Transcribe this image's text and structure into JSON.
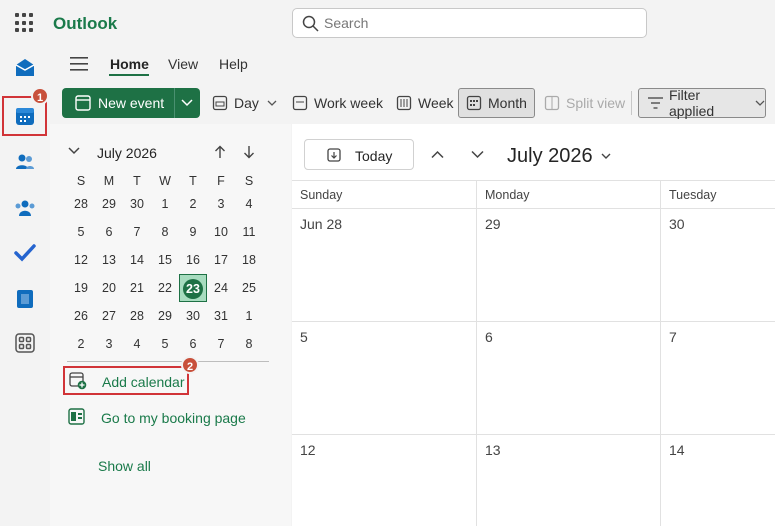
{
  "app": {
    "name": "Outlook"
  },
  "search": {
    "placeholder": "Search"
  },
  "tabs": [
    {
      "label": "Home"
    },
    {
      "label": "View"
    },
    {
      "label": "Help"
    }
  ],
  "ribbon": {
    "new_event": "New event",
    "day": "Day",
    "work_week": "Work week",
    "week": "Week",
    "month": "Month",
    "split_view": "Split view",
    "filter": "Filter applied"
  },
  "mini_calendar": {
    "title": "July 2026",
    "weekdays": [
      "S",
      "M",
      "T",
      "W",
      "T",
      "F",
      "S"
    ],
    "weeks": [
      [
        "28",
        "29",
        "30",
        "1",
        "2",
        "3",
        "4"
      ],
      [
        "5",
        "6",
        "7",
        "8",
        "9",
        "10",
        "11"
      ],
      [
        "12",
        "13",
        "14",
        "15",
        "16",
        "17",
        "18"
      ],
      [
        "19",
        "20",
        "21",
        "22",
        "23",
        "24",
        "25"
      ],
      [
        "26",
        "27",
        "28",
        "29",
        "30",
        "31",
        "1"
      ],
      [
        "2",
        "3",
        "4",
        "5",
        "6",
        "7",
        "8"
      ]
    ],
    "today": "23"
  },
  "left_links": {
    "add_calendar": "Add calendar",
    "booking": "Go to my booking page",
    "show_all": "Show all"
  },
  "calendar": {
    "today_button": "Today",
    "title": "July 2026",
    "day_headers": [
      "Sunday",
      "Monday",
      "Tuesday"
    ],
    "rows": [
      [
        "Jun 28",
        "29",
        "30"
      ],
      [
        "5",
        "6",
        "7"
      ],
      [
        "12",
        "13",
        "14"
      ]
    ]
  },
  "badges": {
    "one": "1",
    "two": "2"
  },
  "colors": {
    "accent": "#1e7145",
    "brand_text": "#1a7a4a",
    "highlight": "#d13438"
  }
}
